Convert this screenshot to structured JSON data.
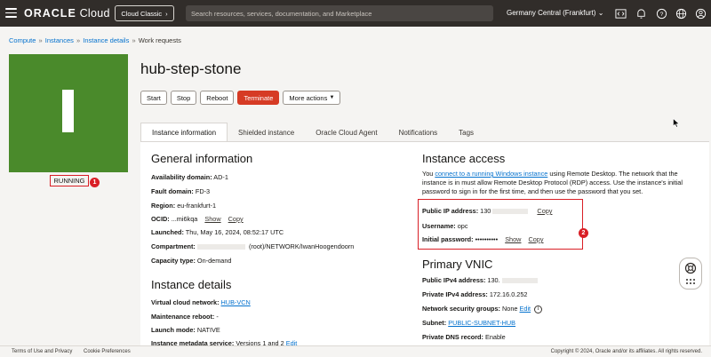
{
  "topbar": {
    "brand_strong": "ORACLE",
    "brand_light": "Cloud",
    "classic_label": "Cloud Classic",
    "search_placeholder": "Search resources, services, documentation, and Marketplace",
    "region": "Germany Central (Frankfurt)"
  },
  "breadcrumb": [
    "Compute",
    "Instances",
    "Instance details",
    "Work requests"
  ],
  "instance": {
    "name": "hub-step-stone",
    "status": "RUNNING"
  },
  "actions": [
    "Start",
    "Stop",
    "Reboot",
    "Terminate",
    "More actions"
  ],
  "tabs": [
    "Instance information",
    "Shielded instance",
    "Oracle Cloud Agent",
    "Notifications",
    "Tags"
  ],
  "general": {
    "title": "General information",
    "availability_domain_label": "Availability domain:",
    "availability_domain": "AD-1",
    "fault_domain_label": "Fault domain:",
    "fault_domain": "FD-3",
    "region_label": "Region:",
    "region": "eu-frankfurt-1",
    "ocid_label": "OCID:",
    "ocid": "...mi6kqa",
    "show": "Show",
    "copy": "Copy",
    "launched_label": "Launched:",
    "launched": "Thu, May 16, 2024, 08:52:17 UTC",
    "compartment_label": "Compartment:",
    "compartment": "(root)/NETWORK/IwanHoogendoorn",
    "capacity_label": "Capacity type:",
    "capacity": "On-demand"
  },
  "details": {
    "title": "Instance details",
    "vcn_label": "Virtual cloud network:",
    "vcn": "HUB-VCN",
    "maint_label": "Maintenance reboot:",
    "maint": "-",
    "launch_mode_label": "Launch mode:",
    "launch_mode": "NATIVE",
    "metadata_label": "Instance metadata service:",
    "metadata": "Versions 1 and 2",
    "edit": "Edit"
  },
  "access": {
    "title": "Instance access",
    "para_pre": "You ",
    "para_link": "connect to a running Windows instance",
    "para_post": " using Remote Desktop. The network that the instance is in must allow Remote Desktop Protocol (RDP) access. Use the instance's initial password to sign in for the first time, and then use the password that you set.",
    "public_ip_label": "Public IP address:",
    "public_ip": "130",
    "copy": "Copy",
    "username_label": "Username:",
    "username": "opc",
    "password_label": "Initial password:",
    "password": "••••••••••",
    "show": "Show"
  },
  "vnic": {
    "title": "Primary VNIC",
    "public_ipv4_label": "Public IPv4 address:",
    "public_ipv4": "130.",
    "private_ipv4_label": "Private IPv4 address:",
    "private_ipv4": "172.16.0.252",
    "nsg_label": "Network security groups:",
    "nsg": "None",
    "edit": "Edit",
    "subnet_label": "Subnet:",
    "subnet": "PUBLIC-SUBNET-HUB",
    "dns_label": "Private DNS record:",
    "dns": "Enable"
  },
  "callouts": [
    "1",
    "2"
  ],
  "footer": {
    "terms": "Terms of Use and Privacy",
    "cookies": "Cookie Preferences",
    "copyright": "Copyright © 2024, Oracle and/or its affiliates. All rights reserved."
  },
  "colors": {
    "accent_red": "#d91f26",
    "running_green": "#4a8a2b",
    "link_blue": "#0572ce",
    "topbar": "#312d2a"
  }
}
